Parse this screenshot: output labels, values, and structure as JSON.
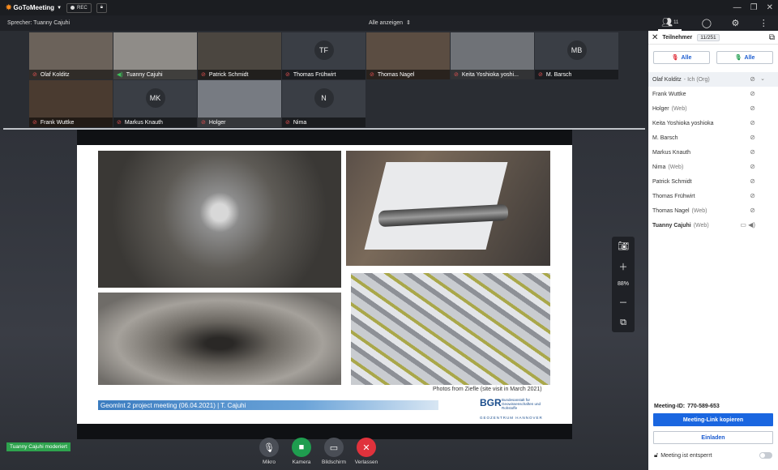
{
  "app": {
    "name": "GoToMeeting",
    "rec_label": "REC"
  },
  "speaker": {
    "label": "Sprecher: Tuanny Cajuhi"
  },
  "view": {
    "show_all": "Alle anzeigen"
  },
  "toolbar": {
    "participants_count": "11"
  },
  "tiles": [
    {
      "name": "Olaf Kolditz",
      "initials": "",
      "mic": "muted",
      "bg": "#6b625a"
    },
    {
      "name": "Tuanny Cajuhi",
      "initials": "",
      "mic": "active",
      "bg": "#8f8c88"
    },
    {
      "name": "Patrick Schmidt",
      "initials": "",
      "mic": "muted",
      "bg": "#4b4640"
    },
    {
      "name": "Thomas Frühwirt",
      "initials": "TF",
      "mic": "muted",
      "bg": "#3a3e45"
    },
    {
      "name": "Thomas Nagel",
      "initials": "",
      "mic": "muted",
      "bg": "#5b4d42"
    },
    {
      "name": "Keita Yoshioka yoshi...",
      "initials": "",
      "mic": "muted",
      "bg": "#6f7277"
    },
    {
      "name": "M. Barsch",
      "initials": "MB",
      "mic": "muted",
      "bg": "#3a3e45"
    },
    {
      "name": "Frank Wuttke",
      "initials": "",
      "mic": "muted",
      "bg": "#4a3b30"
    },
    {
      "name": "Markus Knauth",
      "initials": "MK",
      "mic": "muted",
      "bg": "#3a3e45"
    },
    {
      "name": "Holger",
      "initials": "",
      "mic": "muted",
      "bg": "#777b82"
    },
    {
      "name": "Nima",
      "initials": "N",
      "mic": "muted",
      "bg": "#3a3e45"
    }
  ],
  "slide": {
    "credit": "Photos from Ziefle (site visit in March 2021)",
    "meeting_title": "GeomInt 2 project meeting (06.04.2021) | T. Cajuhi",
    "logo": "BGR",
    "logo_text": "Bundesanstalt für Geowissenschaften und Rohstoffe",
    "geozentrum": "GEOZENTRUM HANNOVER"
  },
  "zoom": {
    "level": "88%"
  },
  "moderator": {
    "label": "Tuanny Cajuhi moderiert"
  },
  "controls": [
    {
      "label": "Mikro",
      "icon": "mic-off-icon",
      "style": "grey"
    },
    {
      "label": "Kamera",
      "icon": "camera-icon",
      "style": "green"
    },
    {
      "label": "Bildschirm",
      "icon": "screen-share-off-icon",
      "style": "grey"
    },
    {
      "label": "Verlassen",
      "icon": "leave-icon",
      "style": "red"
    }
  ],
  "panel": {
    "title": "Teilnehmer",
    "count": "11/251",
    "mute_all": "Alle",
    "unmute_all": "Alle",
    "participants": [
      {
        "name": "Olaf Kolditz",
        "sub": "- Ich (Org)",
        "me": true
      },
      {
        "name": "Frank Wuttke",
        "sub": ""
      },
      {
        "name": "Holger",
        "sub": "(Web)"
      },
      {
        "name": "Keita Yoshioka yoshioka",
        "sub": ""
      },
      {
        "name": "M. Barsch",
        "sub": ""
      },
      {
        "name": "Markus Knauth",
        "sub": ""
      },
      {
        "name": "Nima",
        "sub": "(Web)"
      },
      {
        "name": "Patrick Schmidt",
        "sub": ""
      },
      {
        "name": "Thomas Frühwirt",
        "sub": ""
      },
      {
        "name": "Thomas Nagel",
        "sub": "(Web)"
      },
      {
        "name": "Tuanny Cajuhi",
        "sub": "(Web)",
        "presenter": true
      }
    ],
    "meeting_id_label": "Meeting-ID:",
    "meeting_id": "770-589-653",
    "copy_link": "Meeting-Link kopieren",
    "invite": "Einladen",
    "lock_label": "Meeting ist entsperrt"
  }
}
